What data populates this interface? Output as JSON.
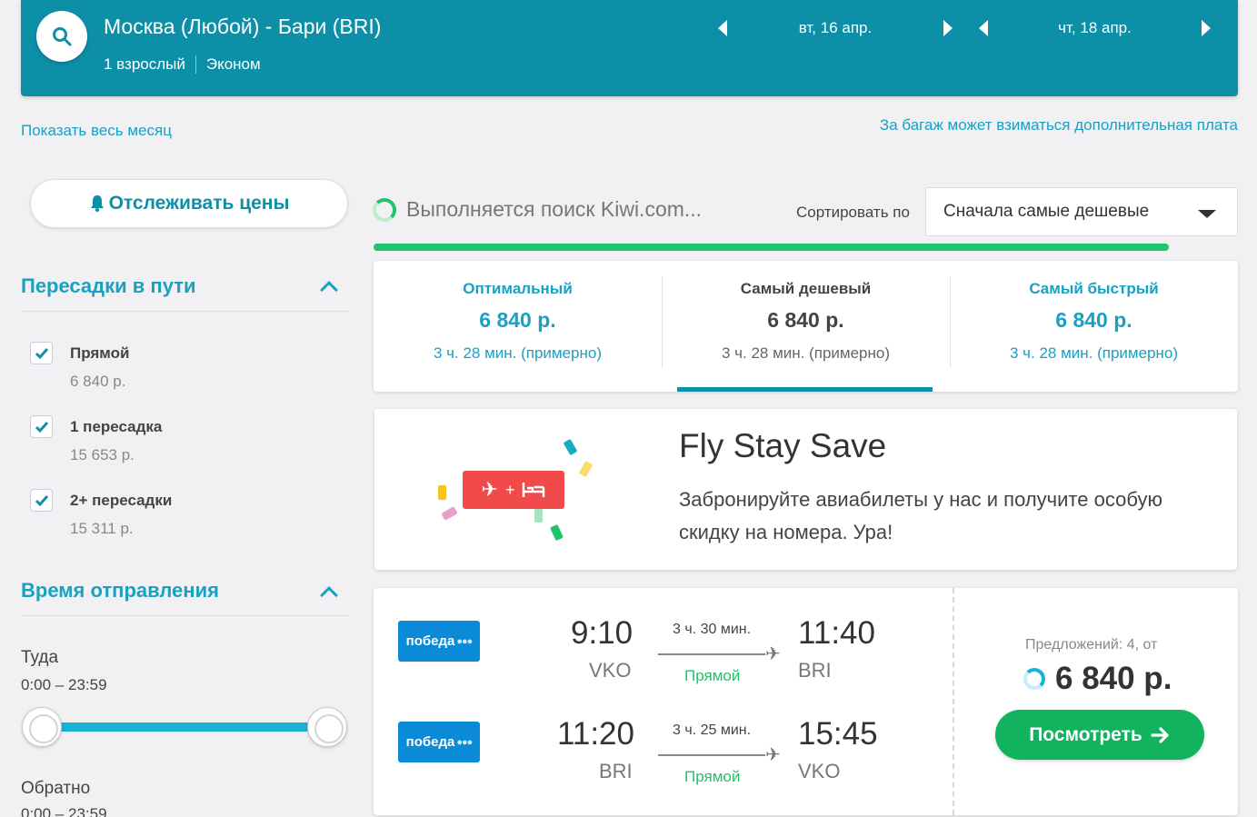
{
  "header": {
    "route": "Москва (Любой) - Бари (BRI)",
    "passengers": "1 взрослый",
    "cabin": "Эконом",
    "departure_date": "вт, 16 апр.",
    "return_date": "чт, 18 апр."
  },
  "links": {
    "show_month": "Показать весь месяц",
    "baggage_note": "За багаж может взиматься дополнительная плата"
  },
  "sidebar": {
    "track_prices": "Отслеживать цены",
    "stops_title": "Пересадки в пути",
    "stops": [
      {
        "label": "Прямой",
        "price": "6 840 р.",
        "checked": true
      },
      {
        "label": "1 пересадка",
        "price": "15 653 р.",
        "checked": true
      },
      {
        "label": "2+ пересадки",
        "price": "15 311 р.",
        "checked": true
      }
    ],
    "departure_time_title": "Время отправления",
    "outbound_label": "Туда",
    "outbound_range": "0:00 – 23:59",
    "return_label": "Обратно",
    "return_range": "0:00 – 23:59"
  },
  "main": {
    "searching_text": "Выполняется поиск Kiwi.com...",
    "sort_label": "Сортировать по",
    "sort_value": "Сначала самые дешевые",
    "tabs": [
      {
        "title": "Оптимальный",
        "price": "6 840 р.",
        "duration": "3 ч. 28 мин. (примерно)"
      },
      {
        "title": "Самый дешевый",
        "price": "6 840 р.",
        "duration": "3 ч. 28 мин. (примерно)"
      },
      {
        "title": "Самый быстрый",
        "price": "6 840 р.",
        "duration": "3 ч. 28 мин. (примерно)"
      }
    ],
    "promo": {
      "title": "Fly Stay Save",
      "text": "Забронируйте авиабилеты у нас и получите особую скидку на номера. Ура!"
    },
    "result": {
      "legs": [
        {
          "airline": "победа",
          "dep_time": "9:10",
          "dep_airport": "VKO",
          "duration": "3 ч. 30 мин.",
          "type": "Прямой",
          "arr_time": "11:40",
          "arr_airport": "BRI"
        },
        {
          "airline": "победа",
          "dep_time": "11:20",
          "dep_airport": "BRI",
          "duration": "3 ч. 25 мин.",
          "type": "Прямой",
          "arr_time": "15:45",
          "arr_airport": "VKO"
        }
      ],
      "offers": "Предложений: 4, от",
      "price": "6 840 р.",
      "view_button": "Посмотреть"
    }
  },
  "colors": {
    "header_bg": "#0e8fa8",
    "accent": "#1aa0c2",
    "success": "#1fc36a",
    "airline_blue": "#0a8ad7",
    "promo_red": "#f04a4a"
  }
}
